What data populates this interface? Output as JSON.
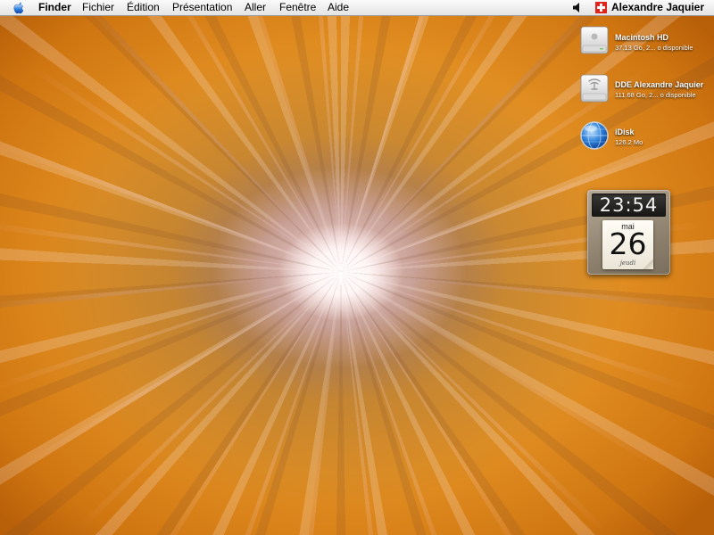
{
  "menubar": {
    "app_name": "Finder",
    "items": [
      "Fichier",
      "Édition",
      "Présentation",
      "Aller",
      "Fenêtre",
      "Aide"
    ],
    "user": "Alexandre Jaquier"
  },
  "desktop": {
    "icons": [
      {
        "name": "Macintosh HD",
        "info": "37.13 Go, 2... o disponible",
        "icon": "hard-drive-icon"
      },
      {
        "name": "DDE Alexandre Jaquier",
        "info": "111.68 Go, 2... o disponible",
        "icon": "firewire-drive-icon"
      },
      {
        "name": "iDisk",
        "info": "126.2 Mo",
        "icon": "idisk-globe-icon"
      }
    ]
  },
  "widget": {
    "time": "23:54",
    "month": "mai",
    "day": "26",
    "weekday": "jeudi"
  },
  "colors": {
    "wallpaper_orange": "#e29023",
    "menubar": "#eeeeee",
    "flag_red": "#e1251b"
  }
}
